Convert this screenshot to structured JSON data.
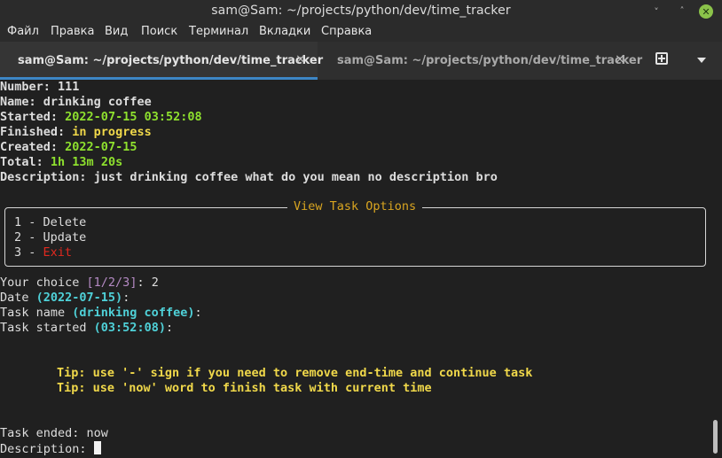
{
  "window": {
    "title": "sam@Sam: ~/projects/python/dev/time_tracker",
    "minimize": "˅",
    "maximize": "˄",
    "close": "✕"
  },
  "menu": [
    "Файл",
    "Правка",
    "Вид",
    "Поиск",
    "Терминал",
    "Вкладки",
    "Справка"
  ],
  "tabs": [
    {
      "label": "sam@Sam: ~/projects/python/dev/time_tracker",
      "close": "×"
    },
    {
      "label": "sam@Sam: ~/projects/python/dev/time_tracker",
      "close": "×"
    }
  ],
  "task": {
    "number_label": "Number:",
    "number": "111",
    "name_label": "Name:",
    "name": "drinking coffee",
    "started_label": "Started:",
    "started": "2022-07-15 03:52:08",
    "finished_label": "Finished:",
    "finished": "in progress",
    "created_label": "Created:",
    "created": "2022-07-15",
    "total_label": "Total:",
    "total": "1h 13m 20s",
    "description_label": "Description:",
    "description": "just drinking coffee what do you mean no description bro"
  },
  "options": {
    "title": "View Task Options",
    "items": [
      {
        "num": "1 - ",
        "label": "Delete"
      },
      {
        "num": "2 - ",
        "label": "Update"
      },
      {
        "num": "3 - ",
        "label": "Exit"
      }
    ]
  },
  "prompts": {
    "choice_label": "Your choice ",
    "choice_options": "[1/2/3]",
    "choice_colon": ": ",
    "choice_value": "2",
    "date_label": "Date ",
    "date_default": "(2022-07-15)",
    "date_colon": ":",
    "taskname_label": "Task name ",
    "taskname_default": "(drinking coffee)",
    "taskname_colon": ":",
    "taskstarted_label": "Task started ",
    "taskstarted_default": "(03:52:08)",
    "taskstarted_colon": ":",
    "tip1": "Tip: use '-' sign if you need to remove end-time and continue task",
    "tip2": "Tip: use 'now' word to finish task with current time",
    "taskended_label": "Task ended: ",
    "taskended_value": "now",
    "description_label": "Description: "
  }
}
